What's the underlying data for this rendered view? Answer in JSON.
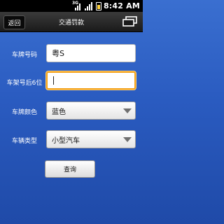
{
  "status_bar": {
    "network_label": "3G",
    "time": "8:42 AM"
  },
  "title_bar": {
    "back_label": "返回",
    "title": "交通罚款"
  },
  "form": {
    "plate_number": {
      "label": "车牌号码",
      "value": "粤S"
    },
    "frame_number": {
      "label": "车架号后6位",
      "value": ""
    },
    "plate_color": {
      "label": "车牌颜色",
      "value": "蓝色"
    },
    "vehicle_type": {
      "label": "车辆类型",
      "value": "小型汽车"
    },
    "submit_label": "查询"
  },
  "colors": {
    "background": "#2a5bc0",
    "focus_border": "#f4a21a",
    "battery": "#ffd23c"
  }
}
